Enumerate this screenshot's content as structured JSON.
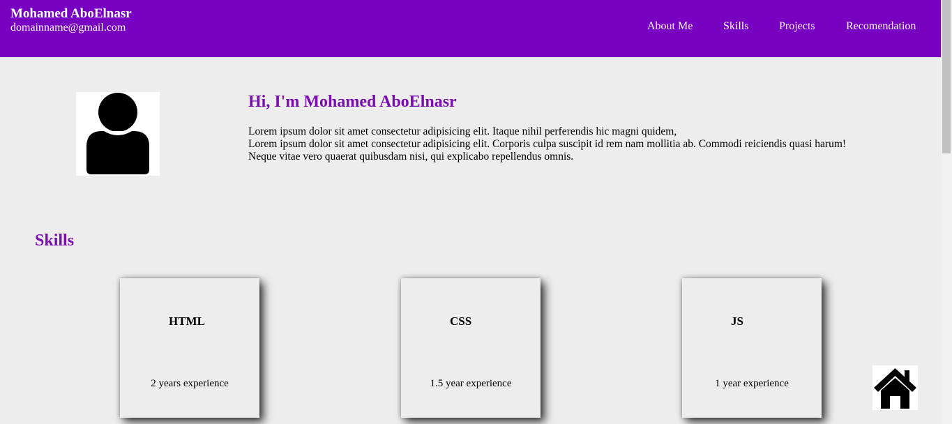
{
  "header": {
    "name": "Mohamed AboElnasr",
    "email": "domainname@gmail.com",
    "nav": [
      "About Me",
      "Skills",
      "Projects",
      "Recomendation"
    ]
  },
  "hero": {
    "title": "Hi, I'm Mohamed AboElnasr",
    "lines": [
      "Lorem ipsum dolor sit amet consectetur adipisicing elit. Itaque nihil perferendis hic magni quidem,",
      "Lorem ipsum dolor sit amet consectetur adipisicing elit. Corporis culpa suscipit id rem nam mollitia ab. Commodi reiciendis quasi harum!",
      "Neque vitae vero quaerat quibusdam nisi, qui explicabo repellendus omnis."
    ]
  },
  "skills": {
    "title": "Skills",
    "cards": [
      {
        "name": "HTML",
        "experience": "2 years experience"
      },
      {
        "name": "CSS",
        "experience": "1.5 year experience"
      },
      {
        "name": "JS",
        "experience": "1 year experience"
      }
    ]
  },
  "icons": {
    "avatar": "user-avatar-icon",
    "home": "home-icon"
  },
  "colors": {
    "header_bg": "#7800c0",
    "accent": "#7a0fb0",
    "page_bg": "#ededed"
  }
}
